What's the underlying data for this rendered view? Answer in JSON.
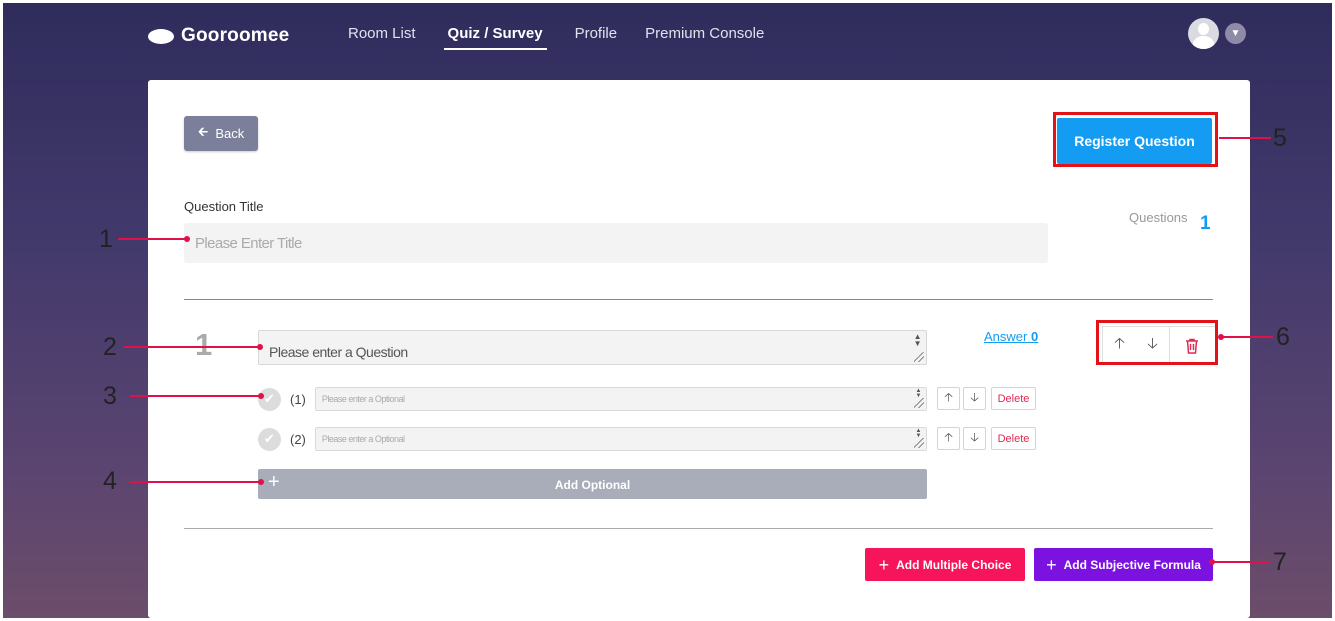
{
  "header": {
    "brand": "Gooroomee",
    "nav": [
      {
        "label": "Room List",
        "active": false
      },
      {
        "label": "Quiz / Survey",
        "active": true
      },
      {
        "label": "Profile",
        "active": false
      },
      {
        "label": "Premium Console",
        "active": false
      }
    ],
    "avatar_icon": "user-avatar-icon",
    "menu_icon": "chevron-down-icon"
  },
  "toolbar": {
    "back_label": "Back",
    "register_label": "Register Question"
  },
  "form": {
    "title_label": "Question Title",
    "title_placeholder": "Please Enter Title",
    "questions_label": "Questions",
    "questions_count": "1"
  },
  "question": {
    "number": "1",
    "placeholder": "Please enter a Question",
    "answer_label": "Answer",
    "answer_count": "0",
    "options": [
      {
        "index": "(1)",
        "placeholder": "Please enter a Optional",
        "delete_label": "Delete"
      },
      {
        "index": "(2)",
        "placeholder": "Please enter a Optional",
        "delete_label": "Delete"
      }
    ],
    "add_optional_label": "Add Optional"
  },
  "footer": {
    "add_multiple_choice_label": "Add Multiple Choice",
    "add_subjective_label": "Add Subjective Formula"
  },
  "annotations": [
    "1",
    "2",
    "3",
    "4",
    "5",
    "6",
    "7"
  ],
  "colors": {
    "primary_blue": "#139cf2",
    "highlight_red": "#e31218",
    "annotation_pink": "#e0104b",
    "multiple_choice_pink": "#f6145a",
    "subjective_purple": "#7c12e0"
  }
}
